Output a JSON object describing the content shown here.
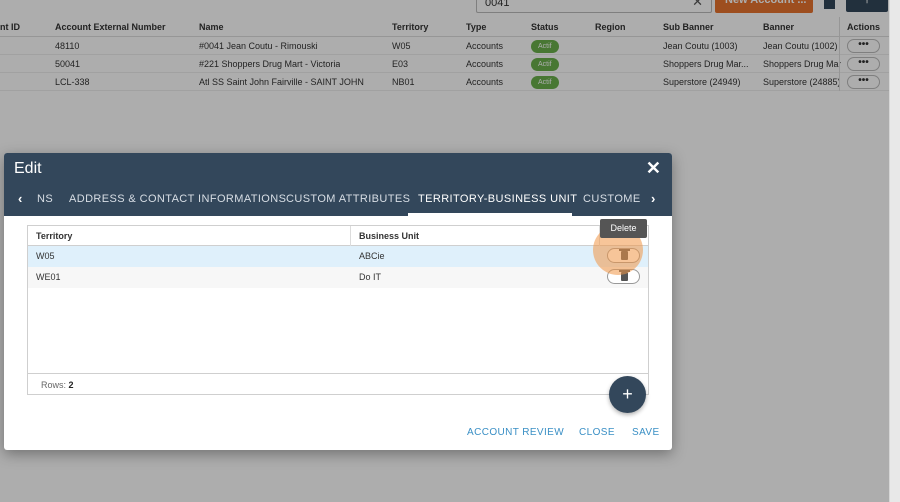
{
  "topbar": {
    "search_value": "0041",
    "clear_symbol": "✕",
    "new_account_label": "New Account ...",
    "filter_symbol": "⚲"
  },
  "background_table": {
    "headers": [
      "nt ID",
      "Account External Number",
      "Name",
      "Territory",
      "Type",
      "Status",
      "Region",
      "Sub Banner",
      "Banner",
      "Actions"
    ],
    "rows": [
      {
        "ext": "48110",
        "name": "#0041 Jean Coutu - Rimouski",
        "territory": "W05",
        "type": "Accounts",
        "status": "Actif",
        "region": "",
        "sub_banner": "Jean Coutu (1003)",
        "banner": "Jean Coutu (1002)",
        "actions": "•••"
      },
      {
        "ext": "50041",
        "name": "#221 Shoppers Drug Mart - Victoria",
        "territory": "E03",
        "type": "Accounts",
        "status": "Actif",
        "region": "",
        "sub_banner": "Shoppers Drug Mar...",
        "banner": "Shoppers Drug Mar...",
        "actions": "•••"
      },
      {
        "ext": "LCL-338",
        "name": "Atl SS Saint John Fairville - SAINT JOHN",
        "territory": "NB01",
        "type": "Accounts",
        "status": "Actif",
        "region": "",
        "sub_banner": "Superstore (24949)",
        "banner": "Superstore (24885)",
        "actions": "•••"
      }
    ]
  },
  "modal": {
    "title": "Edit",
    "close_symbol": "✕",
    "tab_prev_symbol": "‹",
    "tab_next_symbol": "›",
    "tabs": [
      {
        "label": "NS"
      },
      {
        "label": "ADDRESS & CONTACT INFORMATIONS"
      },
      {
        "label": "CUSTOM ATTRIBUTES"
      },
      {
        "label": "TERRITORY-BUSINESS UNIT"
      },
      {
        "label": "CUSTOMEF"
      }
    ],
    "active_tab": "TERRITORY-BUSINESS UNIT",
    "grid": {
      "headers": [
        "Territory",
        "Business Unit"
      ],
      "rows": [
        {
          "territory": "W05",
          "business_unit": "ABCie"
        },
        {
          "territory": "WE01",
          "business_unit": "Do IT"
        }
      ],
      "rows_label": "Rows:",
      "rows_count": "2",
      "delete_tooltip": "Delete"
    },
    "add_symbol": "+",
    "footer": {
      "account_review": "ACCOUNT REVIEW",
      "close": "CLOSE",
      "save": "SAVE"
    }
  },
  "colors": {
    "header_navy": "#33475b",
    "accent_orange": "#e8742f",
    "link_blue": "#3a8fc5",
    "status_green": "#6ab04c",
    "selected_row": "#dff0fb"
  }
}
